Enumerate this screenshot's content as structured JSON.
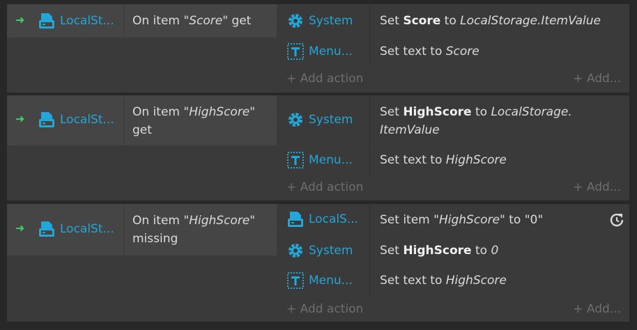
{
  "events": [
    {
      "object": "LocalSt...",
      "condition": {
        "prefix": "On item \"",
        "param": "Score",
        "suffix": "\" get"
      },
      "actions": [
        {
          "object": "System",
          "icon": "gear-icon",
          "prefix": "Set ",
          "bold": "Score",
          "mid": " to ",
          "italic": "LocalStorage.ItemValue"
        },
        {
          "object": "Menu...",
          "icon": "text-object-icon",
          "prefix": "Set text to ",
          "italic": "Score"
        }
      ],
      "add_action": "Add action",
      "add_right": "Add..."
    },
    {
      "object": "LocalSt...",
      "condition": {
        "prefix": "On item \"",
        "param": "HighScore",
        "suffix": "\" get"
      },
      "actions": [
        {
          "object": "System",
          "icon": "gear-icon",
          "prefix": "Set ",
          "bold": "HighScore",
          "mid": " to ",
          "italic": "LocalStorage.",
          "italic2": "ItemValue"
        },
        {
          "object": "Menu...",
          "icon": "text-object-icon",
          "prefix": "Set text to ",
          "italic": "HighScore"
        }
      ],
      "add_action": "Add action",
      "add_right": "Add..."
    },
    {
      "object": "LocalSt...",
      "condition": {
        "prefix": "On item \"",
        "param": "HighScore",
        "suffix": "\"",
        "line2": "missing"
      },
      "actions": [
        {
          "object": "LocalS...",
          "icon": "localstorage-icon",
          "prefix": "Set item \"",
          "italic": "HighScore",
          "suffix": "\" to \"0\""
        },
        {
          "object": "System",
          "icon": "gear-icon",
          "prefix": "Set ",
          "bold": "HighScore",
          "mid": " to ",
          "italic": "0"
        },
        {
          "object": "Menu...",
          "icon": "text-object-icon",
          "prefix": "Set text to ",
          "italic": "HighScore"
        }
      ],
      "add_action": "Add action",
      "add_right": "Add..."
    }
  ],
  "colors": {
    "object_name": "#22a7d8",
    "trigger_arrow": "#3ecf6a",
    "block_bg": "#3a3a3a",
    "condition_bg": "#454545"
  }
}
